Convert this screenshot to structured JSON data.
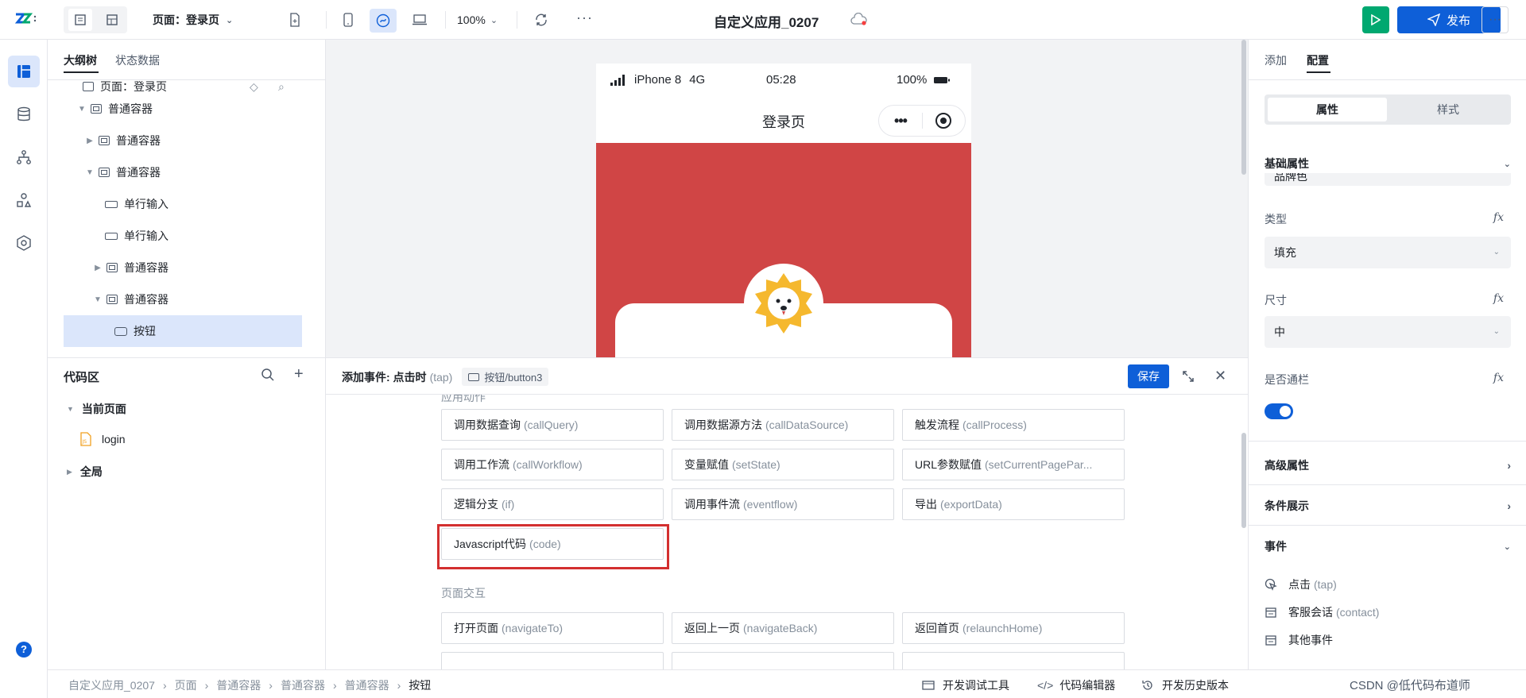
{
  "topbar": {
    "page_selector": "页面：登录页",
    "zoom": "100%",
    "app_title": "自定义应用_0207",
    "publish_label": "发布"
  },
  "outline": {
    "tabs": [
      "大纲树",
      "状态数据"
    ],
    "truncated_row": "页面：登录页",
    "rows": [
      {
        "label": "普通容器"
      },
      {
        "label": "普通容器"
      },
      {
        "label": "普通容器"
      },
      {
        "label": "单行输入"
      },
      {
        "label": "单行输入"
      },
      {
        "label": "普通容器"
      },
      {
        "label": "普通容器"
      },
      {
        "label": "按钮"
      }
    ]
  },
  "code_area": {
    "title": "代码区",
    "current_page": "当前页面",
    "file": "login",
    "global": "全局"
  },
  "phone": {
    "carrier": "iPhone 8",
    "network": "4G",
    "time": "05:28",
    "battery": "100%",
    "nav_title": "登录页",
    "bg_color": "#d04545"
  },
  "event_panel": {
    "title": "添加事件: 点击时",
    "title_en": "(tap)",
    "component": "按钮/button3",
    "save_label": "保存",
    "section_app_actions": "应用动作",
    "section_page_interaction": "页面交互",
    "actions": [
      {
        "cn": "调用数据查询",
        "en": "(callQuery)"
      },
      {
        "cn": "调用数据源方法",
        "en": "(callDataSource)"
      },
      {
        "cn": "触发流程",
        "en": "(callProcess)"
      },
      {
        "cn": "调用工作流",
        "en": "(callWorkflow)"
      },
      {
        "cn": "变量赋值",
        "en": "(setState)"
      },
      {
        "cn": "URL参数赋值",
        "en": "(setCurrentPagePar..."
      },
      {
        "cn": "逻辑分支",
        "en": "(if)"
      },
      {
        "cn": "调用事件流",
        "en": "(eventflow)"
      },
      {
        "cn": "导出",
        "en": "(exportData)"
      },
      {
        "cn": "Javascript代码",
        "en": "(code)"
      }
    ],
    "page_actions": [
      {
        "cn": "打开页面",
        "en": "(navigateTo)"
      },
      {
        "cn": "返回上一页",
        "en": "(navigateBack)"
      },
      {
        "cn": "返回首页",
        "en": "(relaunchHome)"
      }
    ],
    "highlight_color": "#d32f2f"
  },
  "right_panel": {
    "tabs": [
      "添加",
      "配置"
    ],
    "segment": [
      "属性",
      "样式"
    ],
    "basic_props": "基础属性",
    "partial_value": "品牌色",
    "type_label": "类型",
    "type_value": "填充",
    "size_label": "尺寸",
    "size_value": "中",
    "full_width_label": "是否通栏",
    "advanced": "高级属性",
    "conditional": "条件展示",
    "events": "事件",
    "event_items": [
      {
        "cn": "点击",
        "en": "(tap)"
      },
      {
        "cn": "客服会话",
        "en": "(contact)"
      },
      {
        "cn": "其他事件",
        "en": ""
      }
    ]
  },
  "breadcrumb": {
    "items": [
      "自定义应用_0207",
      "页面",
      "普通容器",
      "普通容器",
      "普通容器",
      "按钮"
    ],
    "tools": [
      "开发调试工具",
      "代码编辑器",
      "开发历史版本"
    ],
    "watermark": "CSDN @低代码布道师"
  },
  "colors": {
    "primary": "#0e5fd8",
    "run_green": "#00a870",
    "accent_bg": "#dbe6fb"
  }
}
